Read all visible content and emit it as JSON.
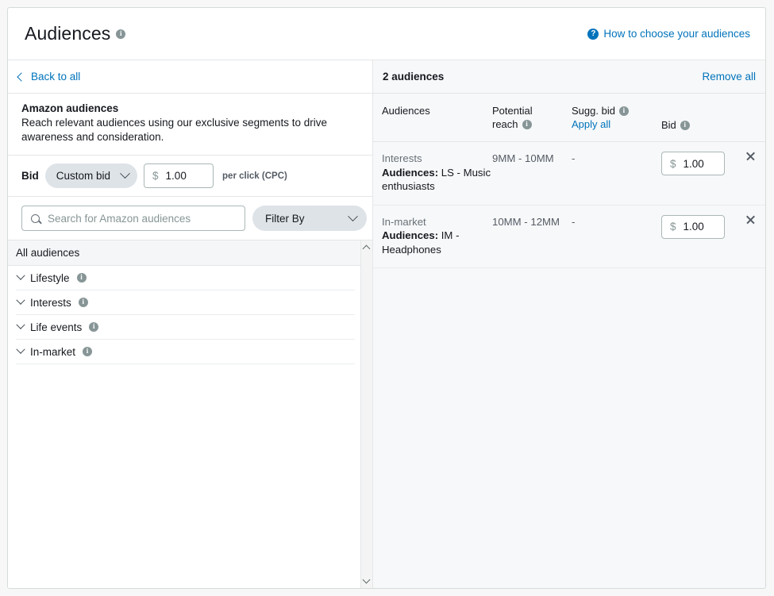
{
  "header": {
    "title": "Audiences",
    "info_icon": "info-icon",
    "help_link": {
      "icon": "question-circle-icon",
      "label": "How to choose your audiences"
    }
  },
  "left_panel": {
    "back_link": {
      "icon": "chevron-left-icon",
      "label": "Back to all"
    },
    "intro": {
      "title": "Amazon audiences",
      "description": "Reach relevant audiences using our exclusive segments to drive awareness and consideration."
    },
    "bid": {
      "label": "Bid",
      "strategy_value": "Custom bid",
      "strategy_icon": "chevron-down-icon",
      "currency_symbol": "$",
      "amount": "1.00",
      "note": "per click (CPC)"
    },
    "search": {
      "icon": "search-icon",
      "placeholder": "Search for Amazon audiences",
      "value": ""
    },
    "filter": {
      "label": "Filter By",
      "icon": "chevron-down-icon"
    },
    "list_header": "All audiences",
    "categories": [
      {
        "label": "Lifestyle",
        "chevron": "chevron-down-icon",
        "info": "info-icon"
      },
      {
        "label": "Interests",
        "chevron": "chevron-down-icon",
        "info": "info-icon"
      },
      {
        "label": "Life events",
        "chevron": "chevron-down-icon",
        "info": "info-icon"
      },
      {
        "label": "In-market",
        "chevron": "chevron-down-icon",
        "info": "info-icon"
      }
    ],
    "scrollbar": {
      "up_icon": "chevron-up-icon",
      "down_icon": "chevron-down-icon"
    }
  },
  "right_panel": {
    "count_label": "2 audiences",
    "remove_all_label": "Remove all",
    "columns": {
      "audiences": "Audiences",
      "potential_reach_line1": "Potential",
      "potential_reach_line2": "reach",
      "sugg_bid": "Sugg. bid",
      "apply_all": "Apply all",
      "bid": "Bid"
    },
    "rows": [
      {
        "category": "Interests",
        "name_prefix": "Audiences:",
        "name": "LS - Music enthusiasts",
        "potential_reach": "9MM - 10MM",
        "sugg_bid": "-",
        "currency_symbol": "$",
        "bid": "1.00",
        "remove_icon": "close-icon"
      },
      {
        "category": "In-market",
        "name_prefix": "Audiences:",
        "name": "IM - Headphones",
        "potential_reach": "10MM - 12MM",
        "sugg_bid": "-",
        "currency_symbol": "$",
        "bid": "1.00",
        "remove_icon": "close-icon"
      }
    ]
  },
  "colors": {
    "link": "#0073bb",
    "text": "#16191f",
    "muted": "#687078",
    "panel_bg": "#f7f8f9",
    "border": "#e3e6e8"
  }
}
